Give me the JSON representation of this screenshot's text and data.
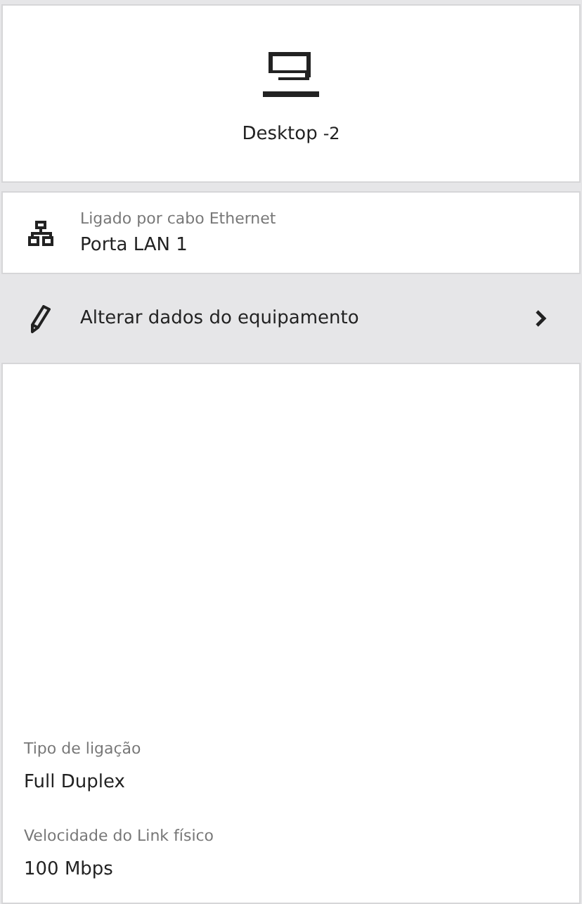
{
  "device": {
    "name": "Desktop",
    "suffix": "-2"
  },
  "connection": {
    "label": "Ligado por cabo Ethernet",
    "value": "Porta LAN 1"
  },
  "action": {
    "label": "Alterar dados do equipamento"
  },
  "details": [
    {
      "label": "Tipo de ligação",
      "value": "Full Duplex"
    },
    {
      "label": "Velocidade do Link físico",
      "value": "100 Mbps"
    }
  ]
}
